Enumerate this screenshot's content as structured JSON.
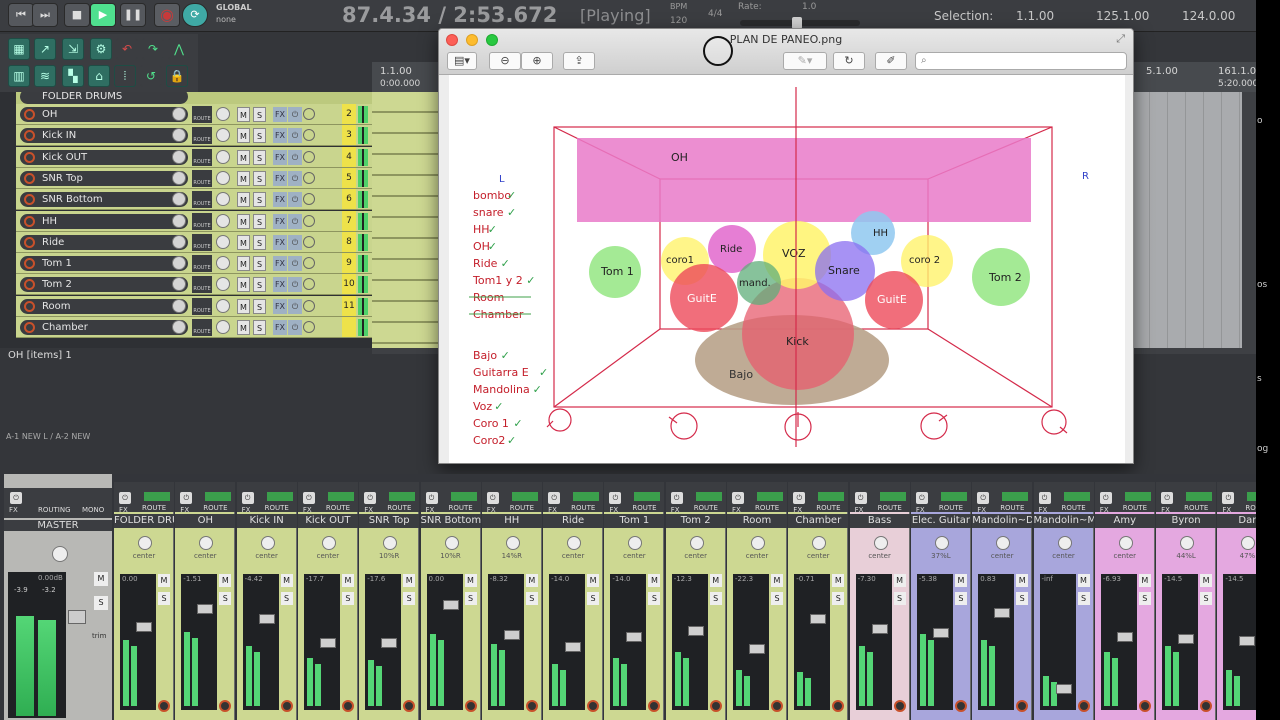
{
  "transport": {
    "time": "87.4.34 / 2:53.672",
    "state": "[Playing]",
    "global_label": "GLOBAL",
    "global_value": "none",
    "bpm_label": "BPM",
    "bpm_value": "120",
    "sig": "4/4",
    "rate_label": "Rate:",
    "rate_value": "1.0",
    "selection_label": "Selection:",
    "sel_start": "1.1.00",
    "sel_end": "125.1.00",
    "sel_len": "124.0.00"
  },
  "tracks": [
    {
      "name": "OH",
      "num": "2"
    },
    {
      "name": "Kick IN",
      "num": "3"
    },
    {
      "name": "Kick OUT",
      "num": "4"
    },
    {
      "name": "SNR Top",
      "num": "5"
    },
    {
      "name": "SNR Bottom",
      "num": "6"
    },
    {
      "name": "HH",
      "num": "7"
    },
    {
      "name": "Ride",
      "num": "8"
    },
    {
      "name": "Tom 1",
      "num": "9"
    },
    {
      "name": "Tom 2",
      "num": "10"
    },
    {
      "name": "Room",
      "num": "11"
    },
    {
      "name": "Chamber",
      "num": ""
    }
  ],
  "folder_label": "FOLDER DRUMS",
  "track_buttons": {
    "route": "ROUTE",
    "mute": "M",
    "solo": "S",
    "fx": "FX"
  },
  "items_status": "OH [items] 1",
  "ruler": {
    "left1": "1.1.00",
    "left2": "0:00.000",
    "r1": "5.1.00",
    "r2": "161.1.00",
    "r3": "5:20.000"
  },
  "automation_label": "A-1 NEW L / A-2 NEW",
  "viewer": {
    "title": "PLAN DE PANEO.png",
    "search_placeholder": "",
    "diagram": {
      "label_L": "L",
      "label_R": "R",
      "oh": "OH",
      "voz": "VOZ",
      "ride": "Ride",
      "hh": "HH",
      "coro1": "coro1",
      "coro2": "coro 2",
      "snare": "Snare",
      "mand": "mand.",
      "guite_l": "GuitE",
      "guite_r": "GuitE",
      "tom1": "Tom 1",
      "tom2": "Tom 2",
      "kick": "Kick",
      "bajo": "Bajo",
      "checklist": [
        "bombo",
        "snare",
        "HH",
        "OH",
        "Ride",
        "Tom1 y 2",
        "Room",
        "Chamber",
        "Bajo",
        "Guitarra E",
        "Mandolina",
        "Voz",
        "Coro 1",
        "Coro2"
      ]
    }
  },
  "master": {
    "label": "MASTER",
    "fx": "FX",
    "routing": "ROUTING",
    "mono": "MONO",
    "vol": "0.00dB",
    "peak_l": "-3.9",
    "peak_r": "-3.2",
    "mute": "M",
    "solo": "S",
    "trim": "trim"
  },
  "strips": [
    {
      "name": "FOLDER DRU",
      "pan": "center",
      "vol": "0.00"
    },
    {
      "name": "OH",
      "pan": "center",
      "vol": "-1.51"
    },
    {
      "name": "Kick IN",
      "pan": "center",
      "vol": "-4.42"
    },
    {
      "name": "Kick OUT",
      "pan": "center",
      "vol": "-17.7"
    },
    {
      "name": "SNR Top",
      "pan": "10%R",
      "vol": "-17.6"
    },
    {
      "name": "SNR Bottom",
      "pan": "10%R",
      "vol": "0.00"
    },
    {
      "name": "HH",
      "pan": "14%R",
      "vol": "-8.32"
    },
    {
      "name": "Ride",
      "pan": "center",
      "vol": "-14.0"
    },
    {
      "name": "Tom 1",
      "pan": "center",
      "vol": "-14.0"
    },
    {
      "name": "Tom 2",
      "pan": "center",
      "vol": "-12.3"
    },
    {
      "name": "Room",
      "pan": "center",
      "vol": "-22.3"
    },
    {
      "name": "Chamber",
      "pan": "center",
      "vol": "-0.71"
    },
    {
      "name": "Bass",
      "pan": "center",
      "vol": "-7.30"
    },
    {
      "name": "Elec. Guitar",
      "pan": "37%L",
      "vol": "-5.38"
    },
    {
      "name": "Mandolin~D",
      "pan": "center",
      "vol": "0.83"
    },
    {
      "name": "Mandolin~M",
      "pan": "center",
      "vol": "-inf"
    },
    {
      "name": "Amy",
      "pan": "center",
      "vol": "-6.93"
    },
    {
      "name": "Byron",
      "pan": "44%L",
      "vol": "-14.5"
    },
    {
      "name": "Dar",
      "pan": "47%",
      "vol": "-14.5"
    }
  ],
  "strip_buttons": {
    "fx": "FX",
    "route": "ROUTE",
    "mute": "M",
    "solo": "S"
  },
  "right_edge": [
    "o",
    "os",
    "s",
    "og"
  ]
}
